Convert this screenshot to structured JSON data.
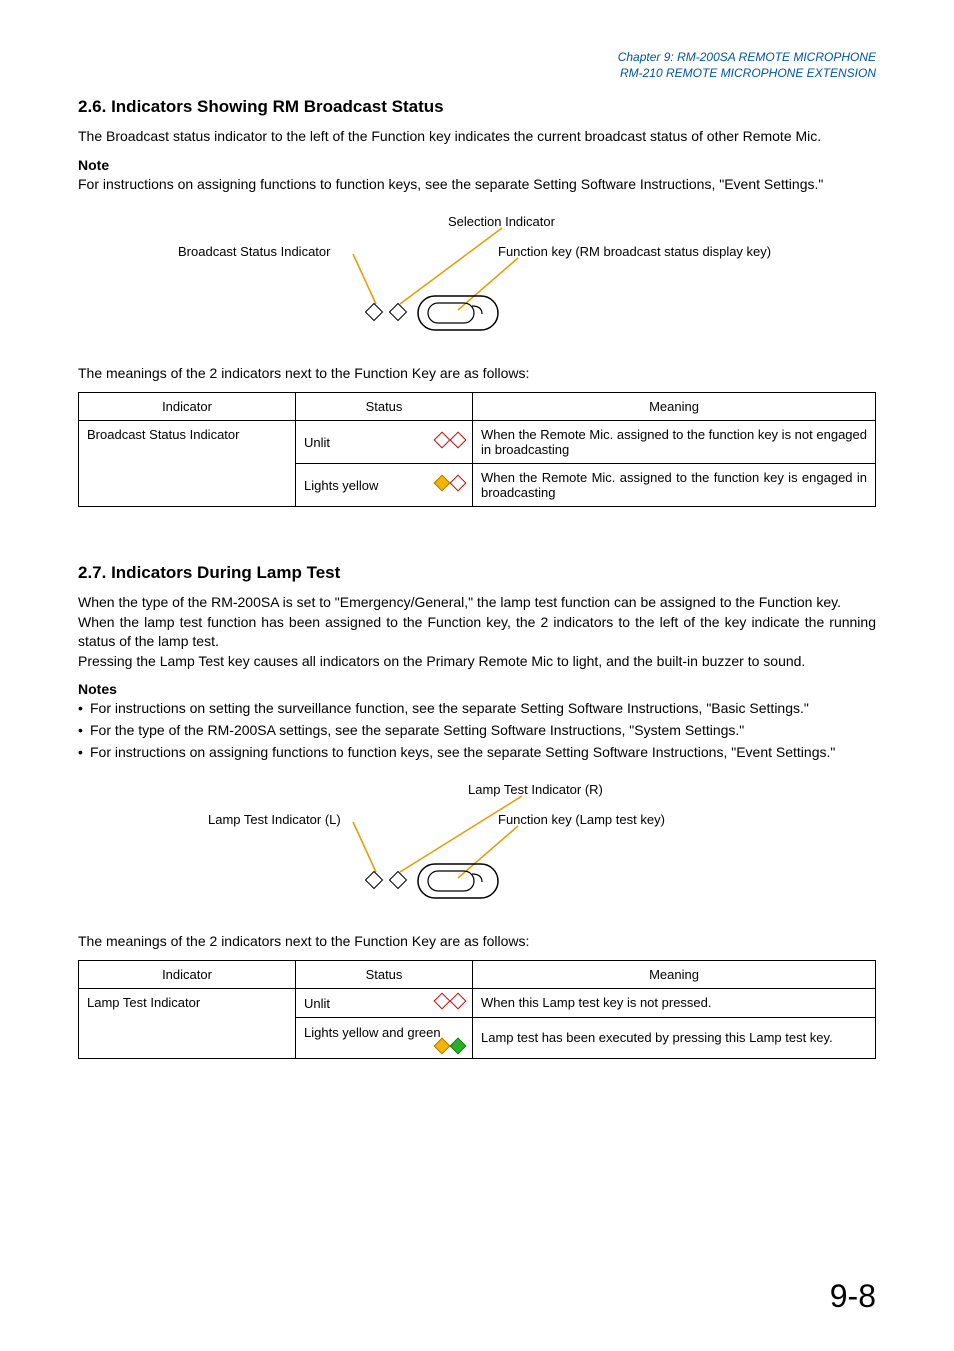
{
  "header": {
    "line1": "Chapter 9: RM-200SA REMOTE MICROPHONE",
    "line2": "RM-210 REMOTE MICROPHONE EXTENSION"
  },
  "section26": {
    "title": "2.6. Indicators Showing RM Broadcast Status",
    "intro": "The Broadcast status indicator to the left of the Function key indicates the current broadcast status of other Remote Mic.",
    "noteLabel": "Note",
    "noteText": "For instructions on assigning functions to function keys, see the separate Setting Software Instructions, \"Event Settings.\"",
    "diagram": {
      "selection": "Selection Indicator",
      "broadcast": "Broadcast Status Indicator",
      "function": "Function key (RM broadcast status display key)"
    },
    "tableIntro": "The meanings of the 2 indicators next to the Function Key are as follows:",
    "table": {
      "headers": [
        "Indicator",
        "Status",
        "Meaning"
      ],
      "rows": [
        {
          "indicator": "Broadcast Status Indicator",
          "status": "Unlit",
          "meaning": "When the Remote Mic. assigned to the function key is not engaged in broadcasting"
        },
        {
          "indicator": "",
          "status": "Lights yellow",
          "meaning": "When the Remote Mic. assigned to the function key is engaged in broadcasting"
        }
      ]
    }
  },
  "section27": {
    "title": "2.7. Indicators During Lamp Test",
    "p1": "When the type of the RM-200SA is set to \"Emergency/General,\" the lamp test function can be assigned to the Function key.",
    "p2": "When the lamp test function has been assigned to the Function key, the 2 indicators to the left of the key indicate the running status of the lamp test.",
    "p3": "Pressing the Lamp Test key causes all indicators on the Primary Remote Mic to light, and the built-in buzzer to sound.",
    "notesLabel": "Notes",
    "notes": [
      "For instructions on setting the surveillance function, see the separate Setting Software Instructions, \"Basic Settings.\"",
      "For the type of the RM-200SA settings, see the separate Setting Software Instructions, \"System Settings.\"",
      "For instructions on assigning functions to function keys, see the separate Setting Software Instructions, \"Event Settings.\""
    ],
    "diagram": {
      "lampR": "Lamp Test Indicator (R)",
      "lampL": "Lamp Test Indicator (L)",
      "function": "Function key (Lamp test key)"
    },
    "tableIntro": "The meanings of the 2 indicators next to the Function Key are as follows:",
    "table": {
      "headers": [
        "Indicator",
        "Status",
        "Meaning"
      ],
      "rows": [
        {
          "indicator": "Lamp Test Indicator",
          "status": "Unlit",
          "meaning": "When this Lamp test key is not pressed."
        },
        {
          "indicator": "",
          "status": "Lights yellow and green",
          "meaning": "Lamp test has been executed by pressing this Lamp test key."
        }
      ]
    }
  },
  "pageNumber": "9-8"
}
